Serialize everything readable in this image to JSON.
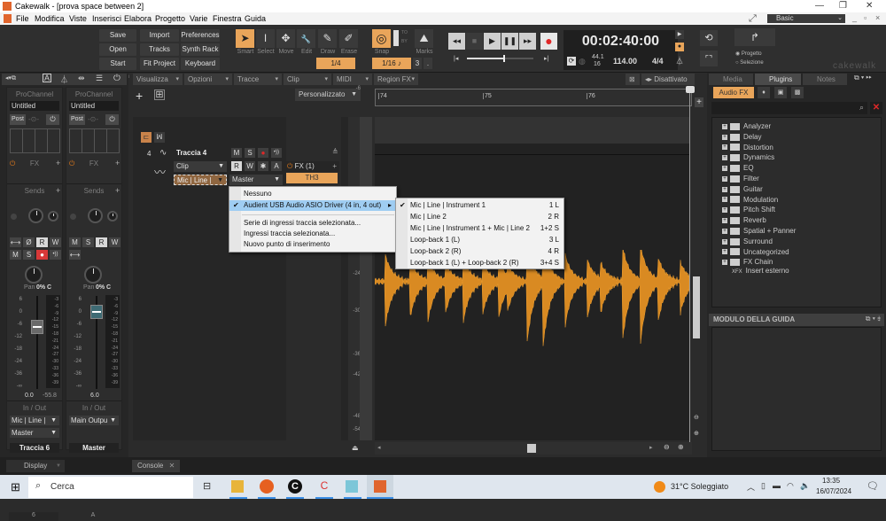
{
  "window": {
    "title": "Cakewalk - [prova space between 2]",
    "minimize": "—",
    "maximize": "❐",
    "close": "✕"
  },
  "menu": [
    "File",
    "Modifica",
    "Viste",
    "Inserisci",
    "Elabora",
    "Progetto",
    "Varie",
    "Finestra",
    "Guida"
  ],
  "workspace": {
    "label": "Basic",
    "expand_icon": "⤢"
  },
  "toolbar": {
    "buttons": [
      [
        "Save",
        "Import",
        "Preferences"
      ],
      [
        "Open",
        "Tracks",
        "Synth Rack"
      ],
      [
        "Start Screen",
        "Fit Project",
        "Keyboard"
      ]
    ],
    "tools": [
      {
        "name": "smart",
        "label": "Smart",
        "glyph": "➤",
        "active": true
      },
      {
        "name": "select",
        "label": "Select",
        "glyph": "I",
        "active": false
      },
      {
        "name": "move",
        "label": "Move",
        "glyph": "✥",
        "active": false
      },
      {
        "name": "edit",
        "label": "Edit",
        "glyph": "🔧",
        "active": false
      },
      {
        "name": "draw",
        "label": "Draw",
        "glyph": "✎",
        "active": false
      },
      {
        "name": "erase",
        "label": "Erase",
        "glyph": "✐",
        "active": false
      }
    ],
    "grid_value": "1/4",
    "snap_label": "Snap",
    "snap_value": "1/16",
    "snap_extra": "3",
    "snap_dot": ".",
    "marks_label": "Marks",
    "to_by": [
      "TO",
      "BY"
    ]
  },
  "transport": {
    "rewind": "◂◂",
    "stop": "■",
    "play": "▶",
    "pause": "❚❚",
    "ffwd": "▸▸",
    "go_start": "|◂",
    "go_end": "▸|",
    "time": "00:02:40:00",
    "sample_rate": "44.1",
    "bit_depth": "16",
    "tempo": "114.00",
    "meter": "4/4",
    "position_fraction": 0.55
  },
  "export": {
    "options": [
      "Progetto",
      "Selezione"
    ],
    "selected": "Progetto",
    "brand": "cakewalk"
  },
  "inspector": {
    "strips": [
      {
        "prochannel": "ProChannel",
        "preset": "Untitled",
        "post": "Post",
        "fx": "FX",
        "sends": "Sends",
        "buttons_row1": [
          "⟷",
          "Ø",
          "R",
          "W"
        ],
        "buttons_row2": [
          "M",
          "S",
          "●",
          "•))"
        ],
        "pan_label": "Pan",
        "pan_value": "0% C",
        "fader_scale": [
          "6",
          "0",
          "-6",
          "-12",
          "-18",
          "-24",
          "-36",
          "-∞"
        ],
        "meter_scale": [
          "-3",
          "-6",
          "-9",
          "-12",
          "-15",
          "-18",
          "-21",
          "-24",
          "-27",
          "-30",
          "-33",
          "-36",
          "-39"
        ],
        "volume": "0.0",
        "peak": "-55.8",
        "io_label": "In / Out",
        "input": "Mic | Line |",
        "output": "Master",
        "name": "Traccia 6",
        "number": "6"
      },
      {
        "prochannel": "ProChannel",
        "preset": "Untitled",
        "post": "Post",
        "fx": "FX",
        "sends": "Sends",
        "buttons_row1": [
          "M",
          "S",
          "R",
          "W"
        ],
        "buttons_row2": [
          "⟷"
        ],
        "pan_label": "Pan",
        "pan_value": "0% C",
        "fader_scale": [
          "6",
          "0",
          "-6",
          "-12",
          "-18",
          "-24",
          "-36",
          "-∞"
        ],
        "meter_scale": [
          "-3",
          "-6",
          "-9",
          "-12",
          "-15",
          "-18",
          "-21",
          "-24",
          "-27",
          "-30",
          "-33",
          "-36",
          "-39"
        ],
        "volume": "6.0",
        "io_label": "In / Out",
        "output": "Main Outpu",
        "name": "Master",
        "number": "A"
      }
    ],
    "display_label": "Display"
  },
  "trackview": {
    "menus": [
      "Visualizza",
      "Opzioni",
      "Tracce",
      "Clip",
      "MIDI",
      "Region FX"
    ],
    "preset": "Personalizzato",
    "ruler_marks": [
      "74",
      "75",
      "76"
    ],
    "disable_label": "Disattivato",
    "track": {
      "number": "4",
      "name": "Traccia 4",
      "clip_mode": "Clip",
      "input": "Mic | Line |",
      "output": "Master",
      "fx_header": "FX (1)",
      "fx_plugin": "TH3",
      "buttons": [
        "M",
        "S",
        "●",
        "•))"
      ],
      "buttons2": [
        "R",
        "W",
        "✱",
        "A"
      ]
    },
    "db_scale": [
      "-6",
      "-24",
      "-30",
      "-36",
      "-42",
      "-48",
      "-54"
    ],
    "console_tab": "Console"
  },
  "input_menu": {
    "items": [
      {
        "label": "Nessuno",
        "checked": false
      },
      {
        "label": "Audient USB Audio ASIO Driver (4 in, 4 out)",
        "checked": true,
        "highlighted": true,
        "submenu": true
      }
    ],
    "items2": [
      "Serie di ingressi traccia selezionata...",
      "Ingressi traccia selezionata...",
      "Nuovo punto di inserimento"
    ],
    "submenu": [
      {
        "label": "Mic | Line | Instrument 1",
        "shortcut": "1 L",
        "checked": true
      },
      {
        "label": "Mic | Line 2",
        "shortcut": "2 R",
        "checked": false
      },
      {
        "label": "Mic | Line | Instrument 1 + Mic | Line 2",
        "shortcut": "1+2 S",
        "checked": false
      },
      {
        "label": "Loop-back 1 (L)",
        "shortcut": "3 L",
        "checked": false
      },
      {
        "label": "Loop-back 2 (R)",
        "shortcut": "4 R",
        "checked": false
      },
      {
        "label": "Loop-back 1 (L) + Loop-back 2 (R)",
        "shortcut": "3+4 S",
        "checked": false
      }
    ]
  },
  "browser": {
    "tabs": [
      "Media",
      "Plugins",
      "Notes"
    ],
    "active_tab": "Plugins",
    "category": "Audio FX",
    "folders": [
      "Analyzer",
      "Delay",
      "Distortion",
      "Dynamics",
      "EQ",
      "Filter",
      "Guitar",
      "Modulation",
      "Pitch Shift",
      "Reverb",
      "Spatial + Panner",
      "Surround",
      "Uncategorized",
      "FX Chain"
    ],
    "extra_item": "Insert esterno",
    "guide_title": "MODULO DELLA GUIDA"
  },
  "colors": {
    "accent": "#e9a55a",
    "waveform": "#d98a22",
    "record": "#d83838",
    "highlight": "#9fcdf2"
  },
  "taskbar": {
    "search_placeholder": "Cerca",
    "weather": "31°C  Soleggiato",
    "time": "13:35",
    "date": "16/07/2024"
  }
}
